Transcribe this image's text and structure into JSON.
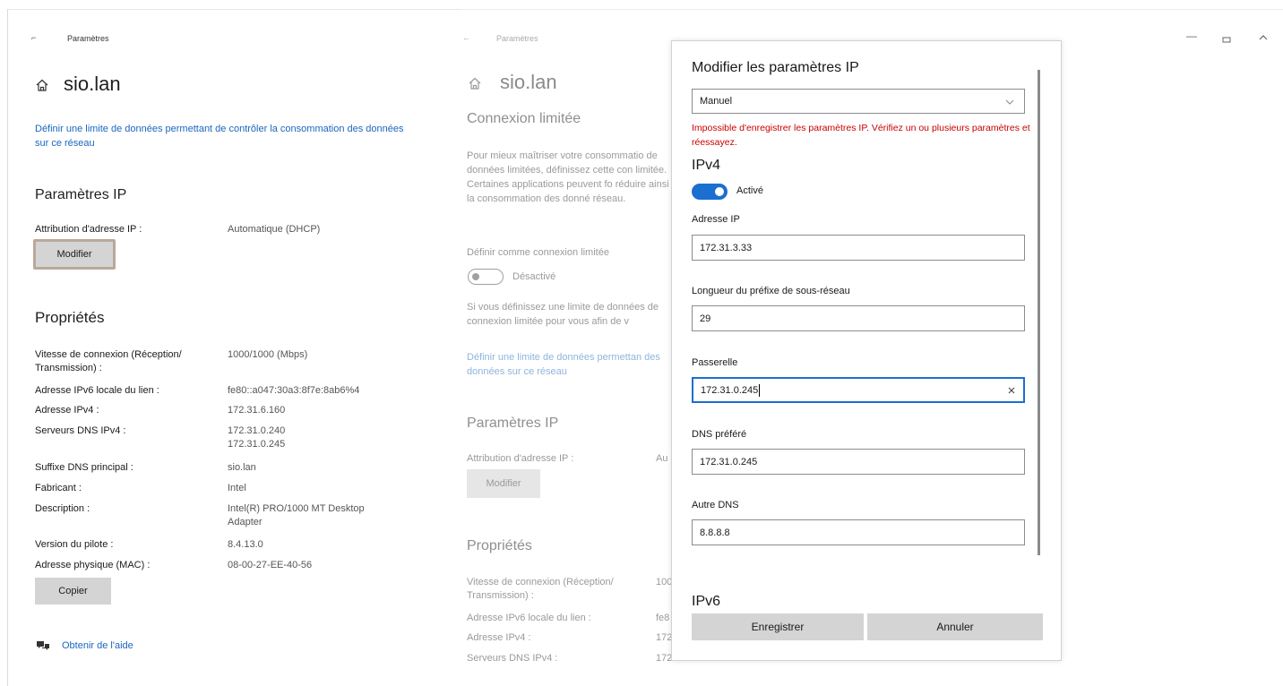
{
  "left": {
    "app_title": "Paramètres",
    "network_name": "sio.lan",
    "data_limit_link": "Définir une limite de données permettant de contrôler la consommation des données sur ce réseau",
    "ip_section_title": "Paramètres IP",
    "ip_assignment_label": "Attribution d'adresse IP :",
    "ip_assignment_value": "Automatique (DHCP)",
    "modify_button": "Modifier",
    "properties_title": "Propriétés",
    "properties": [
      {
        "label": "Vitesse de connexion (Réception/ Transmission) :",
        "value": "1000/1000 (Mbps)"
      },
      {
        "label": "Adresse IPv6 locale du lien :",
        "value": "fe80::a047:30a3:8f7e:8ab6%4"
      },
      {
        "label": "Adresse IPv4 :",
        "value": "172.31.6.160"
      },
      {
        "label": "Serveurs DNS IPv4 :",
        "value": "172.31.0.240\n172.31.0.245"
      },
      {
        "label": "Suffixe DNS principal :",
        "value": "sio.lan"
      },
      {
        "label": "Fabricant :",
        "value": "Intel"
      },
      {
        "label": "Description :",
        "value": "Intel(R) PRO/1000 MT Desktop Adapter"
      },
      {
        "label": "Version du pilote :",
        "value": "8.4.13.0"
      },
      {
        "label": "Adresse physique (MAC) :",
        "value": "08-00-27-EE-40-56"
      }
    ],
    "copy_button": "Copier",
    "help_link": "Obtenir de l'aide"
  },
  "mid": {
    "app_title": "Paramètres",
    "network_name": "sio.lan",
    "metered_title": "Connexion limitée",
    "metered_text": "Pour mieux maîtriser votre consommatio de données limitées, définissez cette con limitée. Certaines applications peuvent fo réduire ainsi la consommation des donné réseau.",
    "metered_toggle_label": "Définir comme connexion limitée",
    "metered_toggle_state": "Désactivé",
    "metered_note": "Si vous définissez une limite de données de connexion limitée pour vous afin de v",
    "data_limit_link": "Définir une limite de données permettan des données sur ce réseau",
    "ip_section_title": "Paramètres IP",
    "ip_assignment_label": "Attribution d'adresse IP :",
    "ip_assignment_value": "Au",
    "modify_button": "Modifier",
    "properties_title": "Propriétés",
    "properties": [
      {
        "label": "Vitesse de connexion (Réception/ Transmission) :",
        "value": "100"
      },
      {
        "label": "Adresse IPv6 locale du lien :",
        "value": "fe8"
      },
      {
        "label": "Adresse IPv4 :",
        "value": "172"
      },
      {
        "label": "Serveurs DNS IPv4 :",
        "value": "172"
      }
    ]
  },
  "dialog": {
    "title": "Modifier les paramètres IP",
    "mode_value": "Manuel",
    "error": "Impossible d'enregistrer les paramètres IP. Vérifiez un ou plusieurs paramètres et réessayez.",
    "ipv4_title": "IPv4",
    "ipv4_toggle_state": "Activé",
    "fields": {
      "ip_label": "Adresse IP",
      "ip_value": "172.31.3.33",
      "prefix_label": "Longueur du préfixe de sous-réseau",
      "prefix_value": "29",
      "gateway_label": "Passerelle",
      "gateway_value": "172.31.0.245",
      "dns_pref_label": "DNS préféré",
      "dns_pref_value": "172.31.0.245",
      "dns_alt_label": "Autre DNS",
      "dns_alt_value": "8.8.8.8"
    },
    "ipv6_title": "IPv6",
    "save_button": "Enregistrer",
    "cancel_button": "Annuler"
  },
  "colors": {
    "accent": "#1a6fd0",
    "link": "#1a66c0",
    "error": "#c80000",
    "button_bg": "#d4d4d4",
    "modify_highlight": "#b9a99a"
  },
  "icons": [
    "home-icon",
    "back-arrow-icon",
    "minimize-icon",
    "maximize-icon",
    "chevron-up-icon",
    "chevron-down-icon",
    "clear-icon",
    "help-icon"
  ]
}
